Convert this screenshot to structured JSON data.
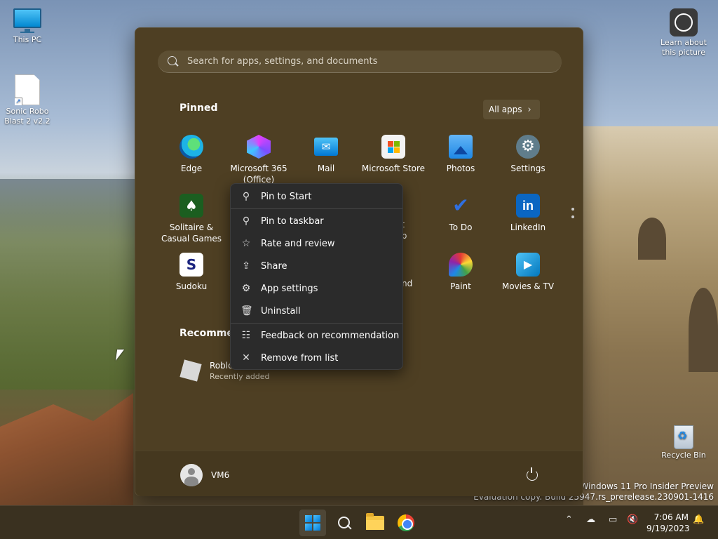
{
  "desktop": {
    "icons": [
      {
        "label": "This PC"
      },
      {
        "label": "Sonic Robo Blast 2 v2.2"
      },
      {
        "label": "Learn about this picture"
      },
      {
        "label": "Recycle Bin"
      }
    ],
    "watermark_line1": "Windows 11 Pro Insider Preview",
    "watermark_line2": "Evaluation copy. Build 25947.rs_prerelease.230901-1416"
  },
  "start_menu": {
    "search_placeholder": "Search for apps, settings, and documents",
    "pinned_title": "Pinned",
    "all_apps_label": "All apps",
    "pinned": [
      {
        "label": "Edge"
      },
      {
        "label": "Microsoft 365 (Office)"
      },
      {
        "label": "Mail"
      },
      {
        "label": "Microsoft Store"
      },
      {
        "label": "Photos"
      },
      {
        "label": "Settings"
      },
      {
        "label": "Solitaire & Casual Games"
      },
      {
        "label": "oft"
      },
      {
        "label": "To Do"
      },
      {
        "label": "LinkedIn"
      },
      {
        "label": "Sudoku"
      },
      {
        "label": "nd"
      },
      {
        "label": "Paint"
      },
      {
        "label": "Movies & TV"
      }
    ],
    "pinned_extra": "mp",
    "recommended_title": "Recommen",
    "recommended": [
      {
        "name": "Roblo",
        "subtitle": "Recently added"
      }
    ],
    "user_name": "VM6"
  },
  "context_menu": {
    "items": [
      {
        "label": "Pin to Start",
        "icon": "pin-icon"
      },
      {
        "label": "Pin to taskbar",
        "icon": "pin-icon"
      },
      {
        "label": "Rate and review",
        "icon": "star-icon"
      },
      {
        "label": "Share",
        "icon": "share-icon"
      },
      {
        "label": "App settings",
        "icon": "gear-icon"
      },
      {
        "label": "Uninstall",
        "icon": "trash-icon"
      },
      {
        "label": "Feedback on recommendation",
        "icon": "feedback-icon"
      },
      {
        "label": "Remove from list",
        "icon": "close-icon"
      }
    ]
  },
  "taskbar": {
    "time": "7:06 AM",
    "date": "9/19/2023"
  }
}
